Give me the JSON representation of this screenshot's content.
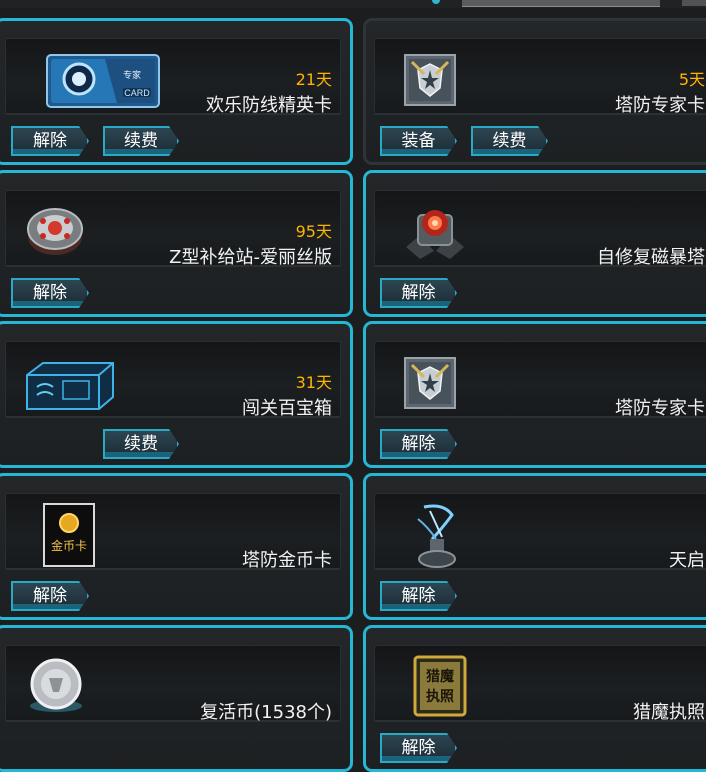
{
  "cards": [
    {
      "name": "欢乐防线精英卡",
      "days": "21天",
      "icon": "elite-card-icon",
      "card_text": "CARD",
      "card_label": "专家",
      "buttons": [
        "解除",
        "续费"
      ]
    },
    {
      "name": "塔防专家卡",
      "days": "5天",
      "icon": "tower-expert-card-icon",
      "buttons": [
        "装备",
        "续费"
      ]
    },
    {
      "name": "Z型补给站-爱丽丝版",
      "days": "95天",
      "icon": "supply-station-icon",
      "buttons": [
        "解除"
      ]
    },
    {
      "name": "自修复磁暴塔",
      "days": "",
      "icon": "tesla-tower-icon",
      "buttons": [
        "解除"
      ]
    },
    {
      "name": "闯关百宝箱",
      "days": "31天",
      "icon": "treasure-box-icon",
      "buttons": [
        "续费"
      ]
    },
    {
      "name": "塔防专家卡",
      "days": "",
      "icon": "tower-expert-card-icon",
      "buttons": [
        "解除"
      ]
    },
    {
      "name": "塔防金币卡",
      "days": "",
      "icon": "gold-coin-card-icon",
      "card_text": "金币卡",
      "buttons": [
        "解除"
      ]
    },
    {
      "name": "天启",
      "days": "",
      "icon": "apocalypse-tower-icon",
      "buttons": [
        "解除"
      ]
    },
    {
      "name": "复活币(1538个)",
      "days": "",
      "icon": "revive-coin-icon",
      "buttons": []
    },
    {
      "name": "猎魔执照",
      "days": "",
      "icon": "demon-hunter-license-icon",
      "license_text": [
        "猎魔",
        "执照"
      ],
      "buttons": [
        "解除"
      ]
    }
  ],
  "colors": {
    "accent": "#25b7d3",
    "days": "#ffb400",
    "text": "#f2f2f2"
  }
}
